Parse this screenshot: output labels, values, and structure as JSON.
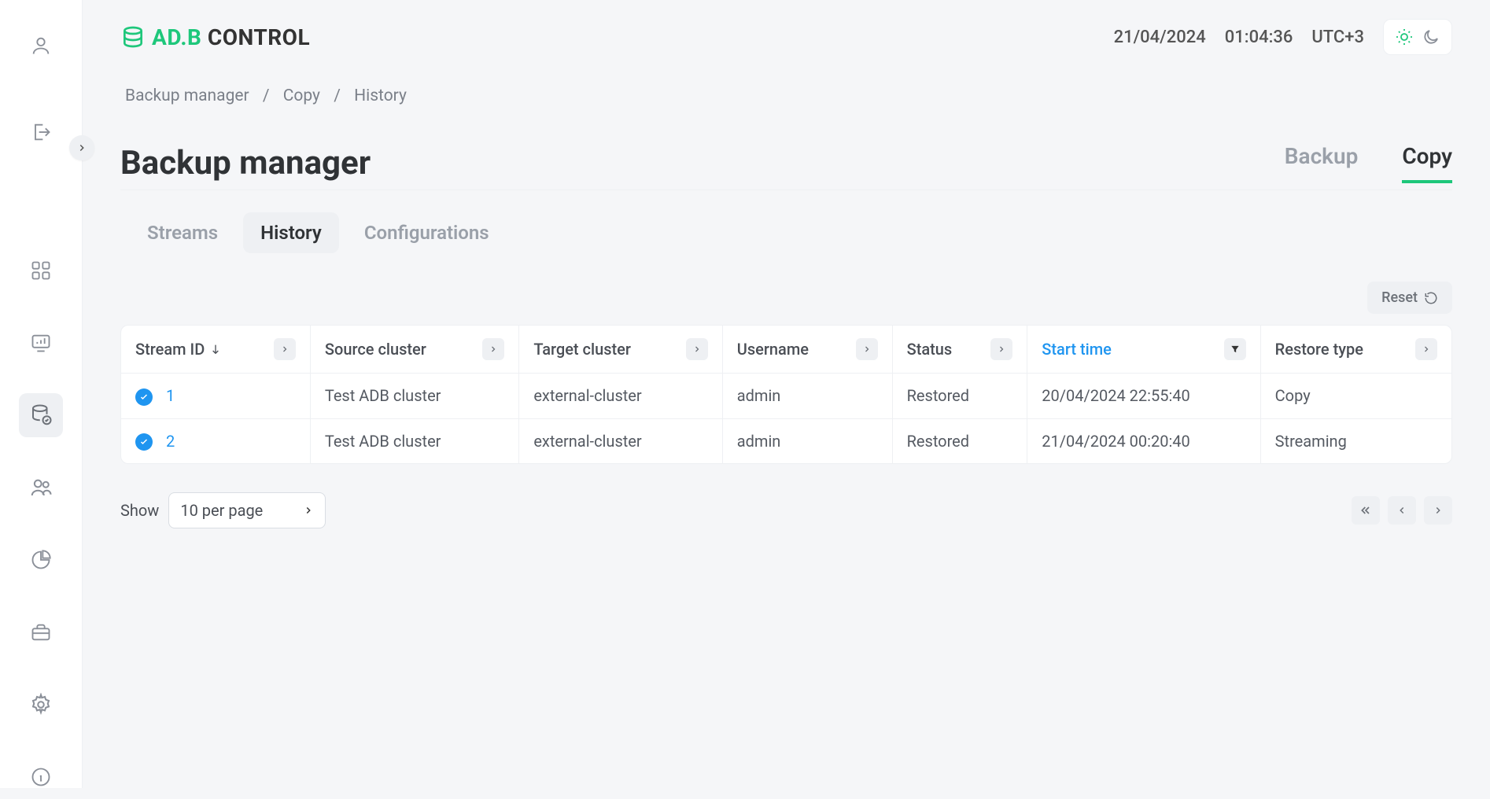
{
  "header": {
    "logo_text_a": "AD.B",
    "logo_text_b": "CONTROL",
    "date": "21/04/2024",
    "time": "01:04:36",
    "tz": "UTC+3"
  },
  "breadcrumb": {
    "a": "Backup manager",
    "b": "Copy",
    "c": "History"
  },
  "page_title": "Backup manager",
  "top_tabs": {
    "backup": "Backup",
    "copy": "Copy"
  },
  "sub_tabs": {
    "streams": "Streams",
    "history": "History",
    "configurations": "Configurations"
  },
  "reset_label": "Reset",
  "columns": {
    "stream_id": "Stream ID",
    "source_cluster": "Source cluster",
    "target_cluster": "Target cluster",
    "username": "Username",
    "status": "Status",
    "start_time": "Start time",
    "restore_type": "Restore type"
  },
  "rows": [
    {
      "id": "1",
      "source": "Test ADB cluster",
      "target": "external-cluster",
      "user": "admin",
      "status": "Restored",
      "start": "20/04/2024 22:55:40",
      "type": "Copy"
    },
    {
      "id": "2",
      "source": "Test ADB cluster",
      "target": "external-cluster",
      "user": "admin",
      "status": "Restored",
      "start": "21/04/2024 00:20:40",
      "type": "Streaming"
    }
  ],
  "pagination": {
    "show_label": "Show",
    "per_page": "10 per page"
  },
  "colors": {
    "accent": "#1ec77b",
    "link": "#1f95f0"
  }
}
